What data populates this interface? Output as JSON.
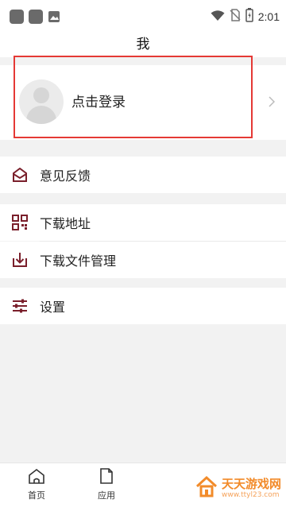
{
  "status_bar": {
    "time": "2:01"
  },
  "header": {
    "title": "我"
  },
  "profile": {
    "login_label": "点击登录"
  },
  "menu": [
    {
      "label": "意见反馈",
      "icon": "mail-icon"
    },
    {
      "label": "下载地址",
      "icon": "qr-code-icon"
    },
    {
      "label": "下载文件管理",
      "icon": "download-icon"
    },
    {
      "label": "设置",
      "icon": "settings-sliders-icon"
    }
  ],
  "tabs": [
    {
      "label": "首页",
      "icon": "home-icon"
    },
    {
      "label": "应用",
      "icon": "document-icon"
    }
  ],
  "watermark": {
    "title": "天天游戏网",
    "url": "www.ttyl23.com"
  },
  "colors": {
    "accent": "#7a1f2b",
    "highlight": "#e53935",
    "watermark": "#f28b2a"
  }
}
